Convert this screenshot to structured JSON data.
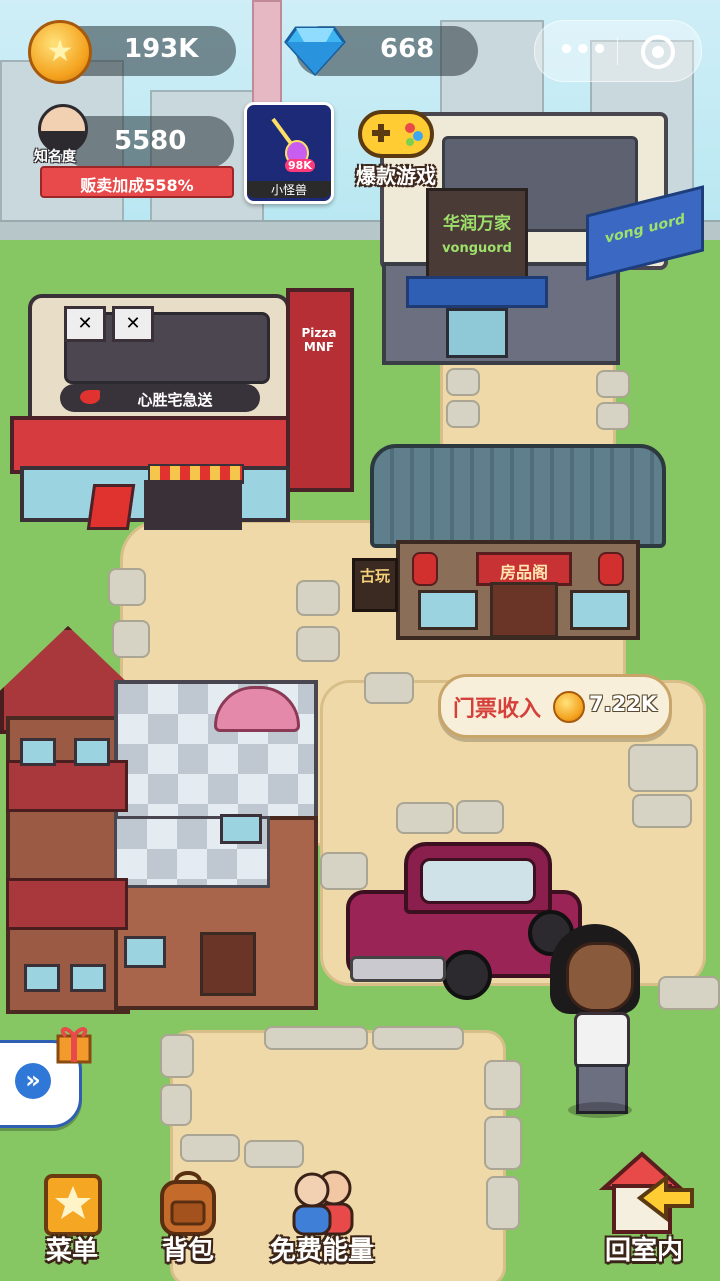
{
  "hud": {
    "coins": "193K",
    "gems": "668",
    "fame_label": "知名度",
    "fame_value": "5580",
    "sales_bonus": "贩卖加成558%",
    "mini_game_label": "小怪兽",
    "mini_game_badge": "98K",
    "hot_games_label": "爆款游戏"
  },
  "capsule": {
    "more_icon": "more-dots-icon",
    "close_icon": "target-circle-icon"
  },
  "buildings": {
    "vanguard_sign": "华润万家",
    "vanguard_sub": "vonguord",
    "vanguard_awning": "vong uord",
    "pizza_sign": "心胜宅急送",
    "pizza_brand": "Pizza MNF",
    "antique_sign": "房品阁",
    "antique_side": "古玩"
  },
  "ticket": {
    "label": "门票收入",
    "value": "7.22K"
  },
  "bottom_nav": {
    "menu": "菜单",
    "bag": "背包",
    "free_energy": "免费能量",
    "go_indoor": "回室内"
  },
  "colors": {
    "grass": "#86c763",
    "path": "#efd9a8",
    "pill": "#37474b",
    "banner_red": "#e8494a",
    "coin_gold": "#f4a21e"
  }
}
